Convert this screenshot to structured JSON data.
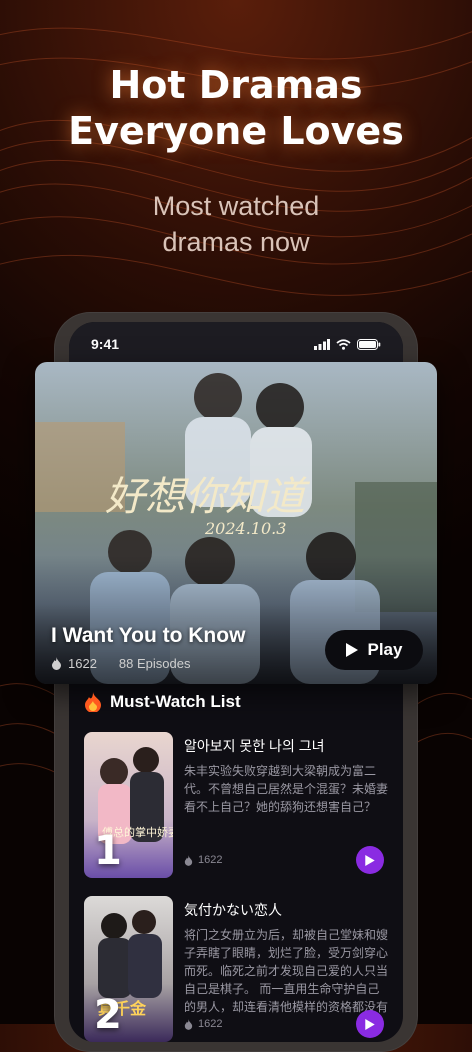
{
  "promo": {
    "headline_line1": "Hot Dramas",
    "headline_line2": "Everyone Loves",
    "subline_line1": "Most watched",
    "subline_line2": "dramas now"
  },
  "status_bar": {
    "time": "9:41"
  },
  "hero": {
    "title": "I Want You to Know",
    "views": "1622",
    "episodes": "88 Episodes",
    "play_label": "Play",
    "poster_text": "好想你知道",
    "poster_date": "2024.10.3"
  },
  "must_watch": {
    "heading": "Must-Watch List",
    "items": [
      {
        "rank": "1",
        "title": "알아보지 못한 나의 그녀",
        "description": "朱丰实验失败穿越到大梁朝成为富二代。不曾想自己居然是个混蛋？未婚妻看不上自己？她的舔狗还想害自己？",
        "views": "1622",
        "poster_text": "傅总的掌中娇妻少女"
      },
      {
        "rank": "2",
        "title": "気付かない恋人",
        "description": "将门之女册立为后，却被自己堂妹和嫂子弄瞎了眼睛，划烂了脸，受万剑穿心而死。临死之前才发现自己爱的人只当自己是棋子。 而一直用生命守护自己的男人，却连看清他模样的资格都没有",
        "views": "1622",
        "poster_text": "真千金"
      }
    ]
  },
  "colors": {
    "accent_purple": "#8a2be2",
    "glow": "#ff8c3c"
  }
}
